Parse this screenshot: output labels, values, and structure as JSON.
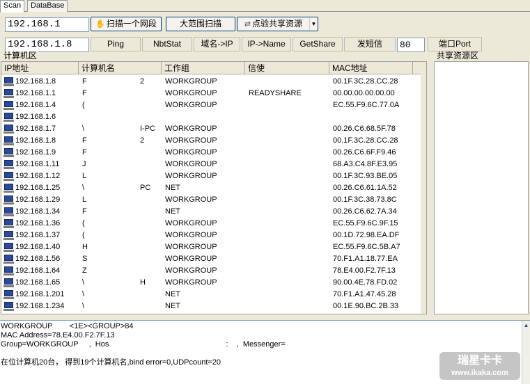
{
  "tabs": [
    {
      "label": "Scan",
      "active": true
    },
    {
      "label": "DataBase",
      "active": false
    }
  ],
  "toolbar1": {
    "ip_start": "192.168.1",
    "scan_segment_label": "扫描一个网段",
    "wide_scan_label": "大范围扫描",
    "share_test_label": "点验共享资源"
  },
  "toolbar2": {
    "ip_target": "192.168.1.8",
    "ping_label": "Ping",
    "nbtstat_label": "NbtStat",
    "domain_to_ip_label": "域名->IP",
    "ip_to_name_label": "IP->Name",
    "getshare_label": "GetShare",
    "sms_label": "发短信",
    "port_value": "80",
    "port_label": "端口Port"
  },
  "groups": {
    "computers": "计算机区",
    "shares": "共享资源区"
  },
  "columns": [
    "IP地址",
    "计算机名",
    "工作组",
    "信使",
    "MAC地址"
  ],
  "rows": [
    {
      "ip": "192.168.1.8",
      "name": "F",
      "name2": "2",
      "group": "WORKGROUP",
      "messenger": "",
      "mac": "00.1F.3C.28.CC.28"
    },
    {
      "ip": "192.168.1.1",
      "name": "F",
      "name2": "",
      "group": "WORKGROUP",
      "messenger": "READYSHARE",
      "mac": "00.00.00.00.00.00"
    },
    {
      "ip": "192.168.1.4",
      "name": "(",
      "name2": "",
      "group": "WORKGROUP",
      "messenger": "",
      "mac": "EC.55.F9.6C.77.0A"
    },
    {
      "ip": "192.168.1.6",
      "name": "",
      "name2": "",
      "group": "",
      "messenger": "",
      "mac": ""
    },
    {
      "ip": "192.168.1.7",
      "name": "\\",
      "name2": "I-PC",
      "group": "WORKGROUP",
      "messenger": "",
      "mac": "00.26.C6.68.5F.78"
    },
    {
      "ip": "192.168.1.8",
      "name": "F",
      "name2": "2",
      "group": "WORKGROUP",
      "messenger": "",
      "mac": "00.1F.3C.28.CC.28"
    },
    {
      "ip": "192.168.1.9",
      "name": "F",
      "name2": "",
      "group": "WORKGROUP",
      "messenger": "",
      "mac": "00.26.C6.6F.F9.46"
    },
    {
      "ip": "192.168.1.11",
      "name": "J",
      "name2": "",
      "group": "WORKGROUP",
      "messenger": "",
      "mac": "68.A3.C4.8F.E3.95"
    },
    {
      "ip": "192.168.1.12",
      "name": "L",
      "name2": "",
      "group": "WORKGROUP",
      "messenger": "",
      "mac": "00.1F.3C.93.BE.05"
    },
    {
      "ip": "192.168.1.25",
      "name": "\\",
      "name2": "PC",
      "group": "NET",
      "messenger": "",
      "mac": "00.26.C6.61.1A.52"
    },
    {
      "ip": "192.168.1.29",
      "name": "L",
      "name2": "",
      "group": "WORKGROUP",
      "messenger": "",
      "mac": "00.1F.3C.38.73.8C"
    },
    {
      "ip": "192.168.1.34",
      "name": "F",
      "name2": "",
      "group": "NET",
      "messenger": "",
      "mac": "00.26.C6.62.7A.34"
    },
    {
      "ip": "192.168.1.36",
      "name": "(",
      "name2": "",
      "group": "WORKGROUP",
      "messenger": "",
      "mac": "EC.55.F9.6C.9F.15"
    },
    {
      "ip": "192.168.1.37",
      "name": "(",
      "name2": "",
      "group": "WORKGROUP",
      "messenger": "",
      "mac": "00.1D.72.98.EA.DF"
    },
    {
      "ip": "192.168.1.40",
      "name": "H",
      "name2": "",
      "group": "WORKGROUP",
      "messenger": "",
      "mac": "EC.55.F9.6C.5B.A7"
    },
    {
      "ip": "192.168.1.56",
      "name": "S",
      "name2": "",
      "group": "WORKGROUP",
      "messenger": "",
      "mac": "70.F1.A1.18.77.EA"
    },
    {
      "ip": "192.168.1.64",
      "name": "Z",
      "name2": "",
      "group": "WORKGROUP",
      "messenger": "",
      "mac": "78.E4.00.F2.7F.13"
    },
    {
      "ip": "192.168.1.65",
      "name": "\\",
      "name2": "H",
      "group": "WORKGROUP",
      "messenger": "",
      "mac": "90.00.4E.78.FD.02"
    },
    {
      "ip": "192.168.1.201",
      "name": "\\",
      "name2": "",
      "group": "NET",
      "messenger": "",
      "mac": "70.F1.A1.47.45.28"
    },
    {
      "ip": "192.168.1.234",
      "name": "\\",
      "name2": "",
      "group": "NET",
      "messenger": "",
      "mac": "00.1E.90.BC.2B.33"
    }
  ],
  "log": {
    "line1": "WORKGROUP        <1E><GROUP>84",
    "line2": "MAC Address=78.E4.00.F2.7F.13",
    "line3": "Group=WORKGROUP     ,  Hos                                                       :    ,  Messenger=",
    "line4": "在位计算机20台， 得到19个计算机名,bind error=0,UDPcount=20"
  },
  "watermark": {
    "line1": "瑞星卡卡",
    "line2": "www.ikaka.com"
  }
}
